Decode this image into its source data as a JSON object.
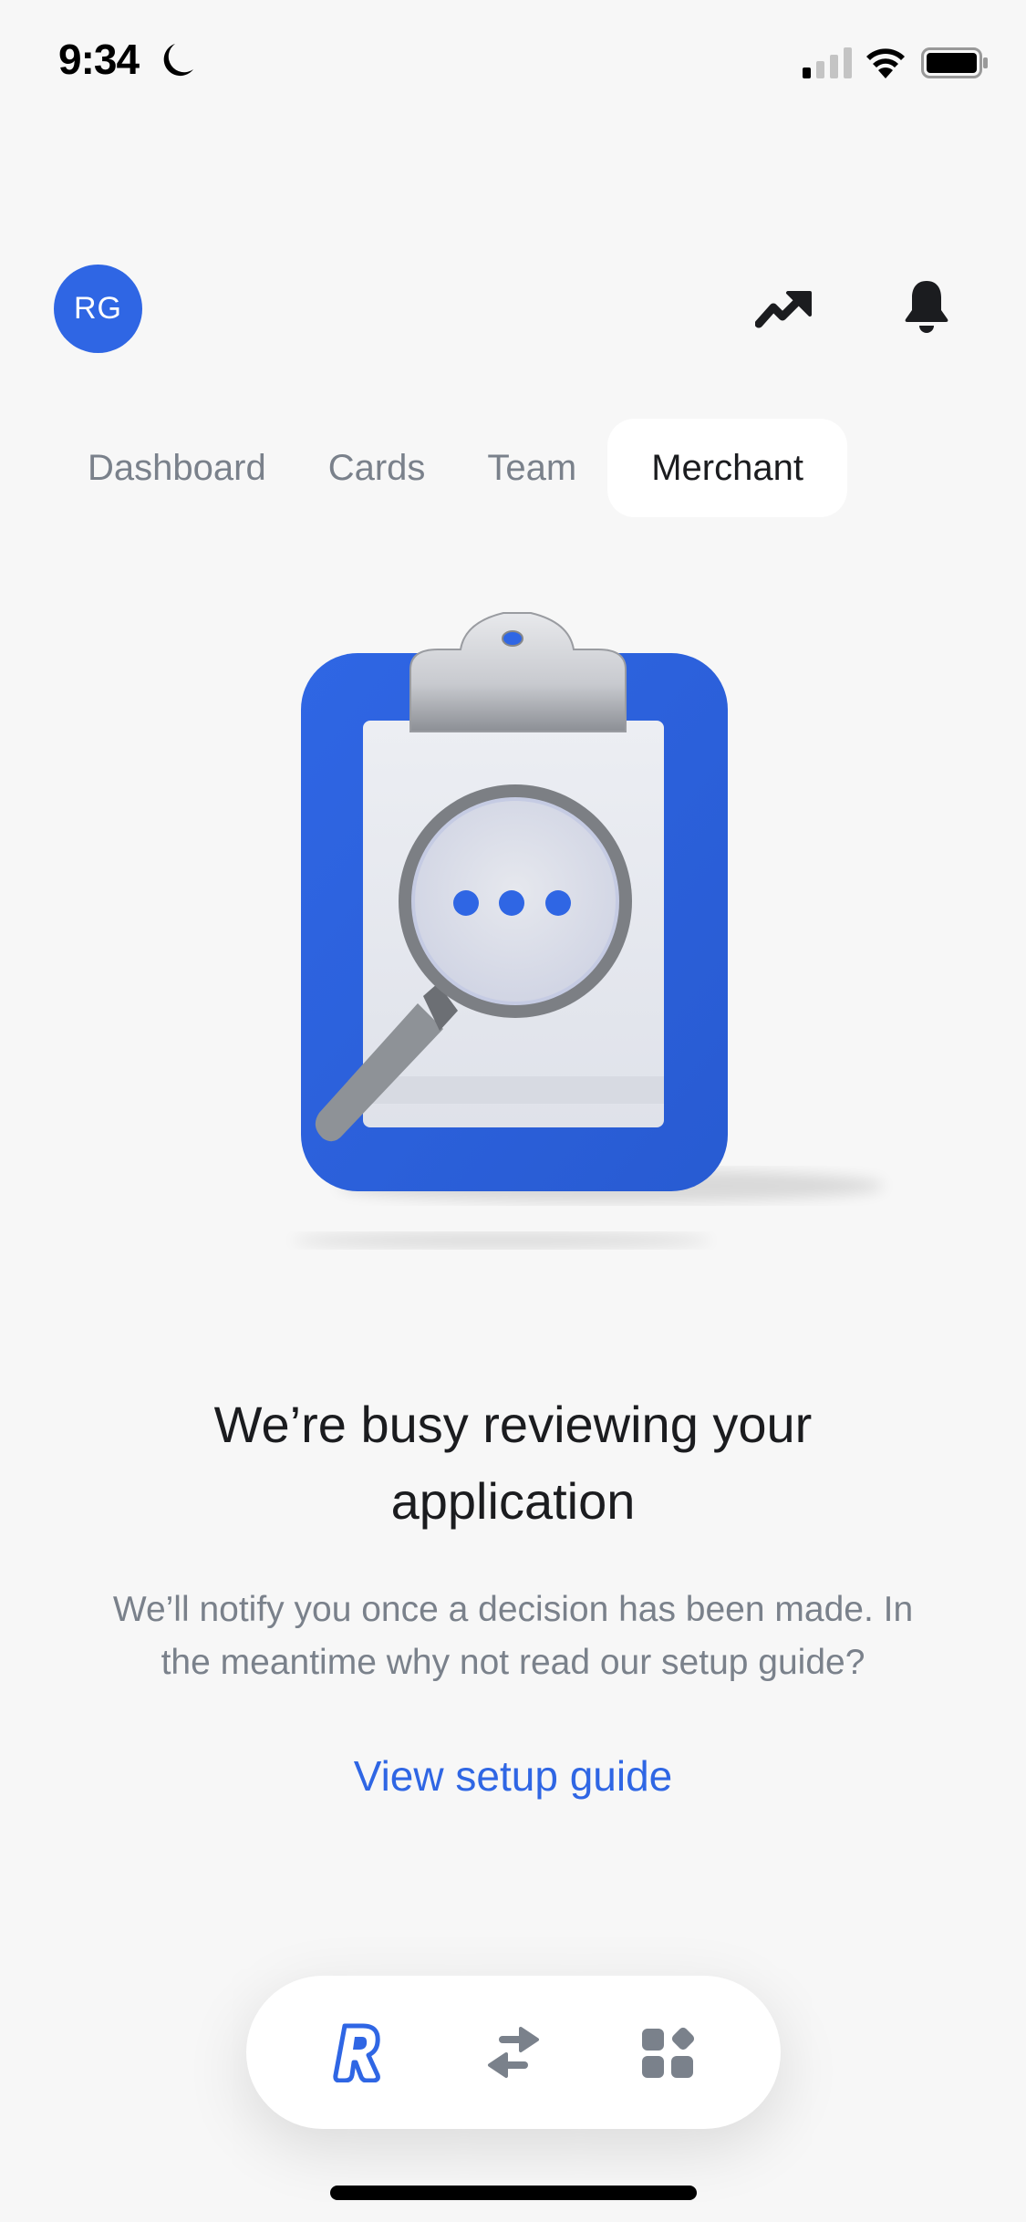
{
  "status_bar": {
    "time": "9:34",
    "focus_icon": "moon-icon",
    "signal_icon": "cellular-signal-icon",
    "wifi_icon": "wifi-icon",
    "battery_icon": "battery-icon"
  },
  "header": {
    "avatar_initials": "RG",
    "avatar_color": "#2f66e4",
    "actions": [
      {
        "icon": "trend-up-icon"
      },
      {
        "icon": "bell-icon"
      }
    ]
  },
  "tabs": [
    {
      "label": "Dashboard",
      "active": false
    },
    {
      "label": "Cards",
      "active": false
    },
    {
      "label": "Team",
      "active": false
    },
    {
      "label": "Merchant",
      "active": true
    }
  ],
  "main": {
    "illustration": "clipboard-magnifier-illustration",
    "title_line1": "We’re busy reviewing your",
    "title_line2": "application",
    "subtitle_line1": "We’ll notify you once a decision has been made. In",
    "subtitle_line2": "the meantime why not read our setup guide?",
    "link_label": "View setup guide"
  },
  "bottom_nav": [
    {
      "icon": "revolut-r-icon",
      "active": true
    },
    {
      "icon": "transfer-arrows-icon",
      "active": false
    },
    {
      "icon": "apps-grid-icon",
      "active": false
    }
  ],
  "colors": {
    "accent": "#2f66e4",
    "background": "#f7f7f7",
    "muted_text": "#7a818b",
    "primary_text": "#1b1c1f"
  }
}
